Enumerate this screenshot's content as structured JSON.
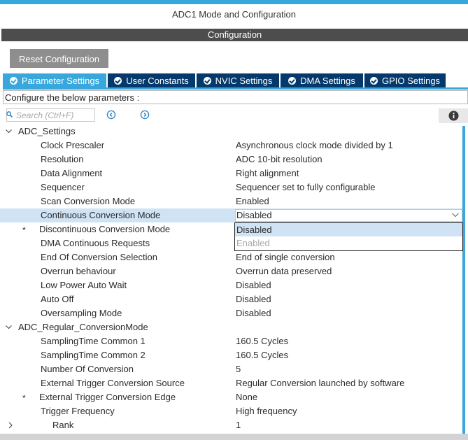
{
  "window": {
    "title": "ADC1 Mode and Configuration"
  },
  "config_bar": {
    "label": "Configuration"
  },
  "reset_button": {
    "label": "Reset Configuration"
  },
  "tabs": [
    {
      "label": "Parameter Settings",
      "active": true
    },
    {
      "label": "User Constants"
    },
    {
      "label": "NVIC Settings"
    },
    {
      "label": "DMA Settings"
    },
    {
      "label": "GPIO Settings"
    }
  ],
  "hint": "Configure the below parameters :",
  "search": {
    "placeholder": "Search (Ctrl+F)"
  },
  "icons": {
    "search": "search-icon",
    "prev": "circle-left-icon",
    "next": "circle-right-icon",
    "info": "info-icon",
    "expand": "chevron-down-icon",
    "collapse": "chevron-right-icon"
  },
  "colors": {
    "accent": "#37a7dc",
    "tab_dark": "#05396b",
    "selection": "#cfe3f5",
    "config_bar": "#4d4d4d"
  },
  "groups": {
    "adc_settings": {
      "name": "ADC_Settings",
      "params": [
        {
          "name": "Clock Prescaler",
          "value": "Asynchronous clock mode divided by 1"
        },
        {
          "name": "Resolution",
          "value": "ADC 10-bit resolution"
        },
        {
          "name": "Data Alignment",
          "value": "Right alignment"
        },
        {
          "name": "Sequencer",
          "value": "Sequencer set to fully configurable"
        },
        {
          "name": "Scan Conversion Mode",
          "value": "Enabled"
        },
        {
          "name": "Continuous Conversion Mode",
          "value": "Disabled"
        },
        {
          "name": "Discontinuous Conversion Mode",
          "value": "",
          "star": "*"
        },
        {
          "name": "DMA Continuous Requests",
          "value": ""
        },
        {
          "name": "End Of Conversion Selection",
          "value": "End of single conversion"
        },
        {
          "name": "Overrun behaviour",
          "value": "Overrun data preserved"
        },
        {
          "name": "Low Power Auto Wait",
          "value": "Disabled"
        },
        {
          "name": "Auto Off",
          "value": "Disabled"
        },
        {
          "name": "Oversampling Mode",
          "value": "Disabled"
        }
      ]
    },
    "regular": {
      "name": "ADC_Regular_ConversionMode",
      "params": [
        {
          "name": "SamplingTime Common 1",
          "value": "160.5 Cycles"
        },
        {
          "name": "SamplingTime Common 2",
          "value": "160.5 Cycles"
        },
        {
          "name": "Number Of Conversion",
          "value": "5"
        },
        {
          "name": "External Trigger Conversion Source",
          "value": "Regular Conversion launched by software"
        },
        {
          "name": "External Trigger Conversion Edge",
          "value": "None",
          "star": "*"
        },
        {
          "name": "Trigger Frequency",
          "value": "High frequency"
        }
      ],
      "rank": {
        "name": "Rank",
        "value": "1"
      }
    }
  },
  "dropdown": {
    "options": [
      {
        "label": "Disabled",
        "highlighted": true
      },
      {
        "label": "Enabled",
        "disabled": true
      }
    ]
  }
}
